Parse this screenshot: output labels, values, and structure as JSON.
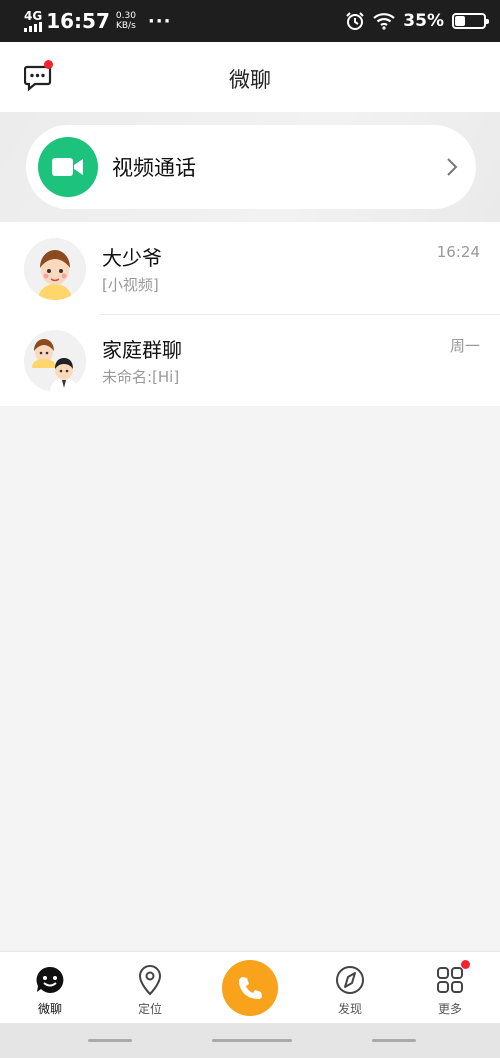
{
  "statusbar": {
    "network": "4G",
    "time": "16:57",
    "speed_value": "0.30",
    "speed_unit": "KB/s",
    "more": "···",
    "battery_pct": "35%",
    "battery_level": 0.35,
    "icons": [
      "signal-icon",
      "alarm-icon",
      "wifi-icon",
      "battery-icon"
    ]
  },
  "header": {
    "title": "微聊",
    "left_icon": "message-icon",
    "has_notification": true
  },
  "video_call": {
    "label": "视频通话",
    "icon": "video-camera-icon",
    "accent": "#1dc27c"
  },
  "chats": [
    {
      "name": "大少爷",
      "preview": "[小视频]",
      "time": "16:24",
      "avatar": "boy-avatar"
    },
    {
      "name": "家庭群聊",
      "preview": "未命名:[Hi]",
      "time": "周一",
      "avatar": "group-avatar"
    }
  ],
  "nav": [
    {
      "label": "微聊",
      "icon": "chat-face-icon",
      "active": true
    },
    {
      "label": "定位",
      "icon": "location-pin-icon"
    },
    {
      "label": "",
      "icon": "phone-icon"
    },
    {
      "label": "发现",
      "icon": "compass-icon"
    },
    {
      "label": "更多",
      "icon": "grid-icon",
      "has_notification": true
    }
  ],
  "colors": {
    "call_button": "#f9a21c",
    "badge": "#f5222d",
    "video": "#1dc27c"
  }
}
